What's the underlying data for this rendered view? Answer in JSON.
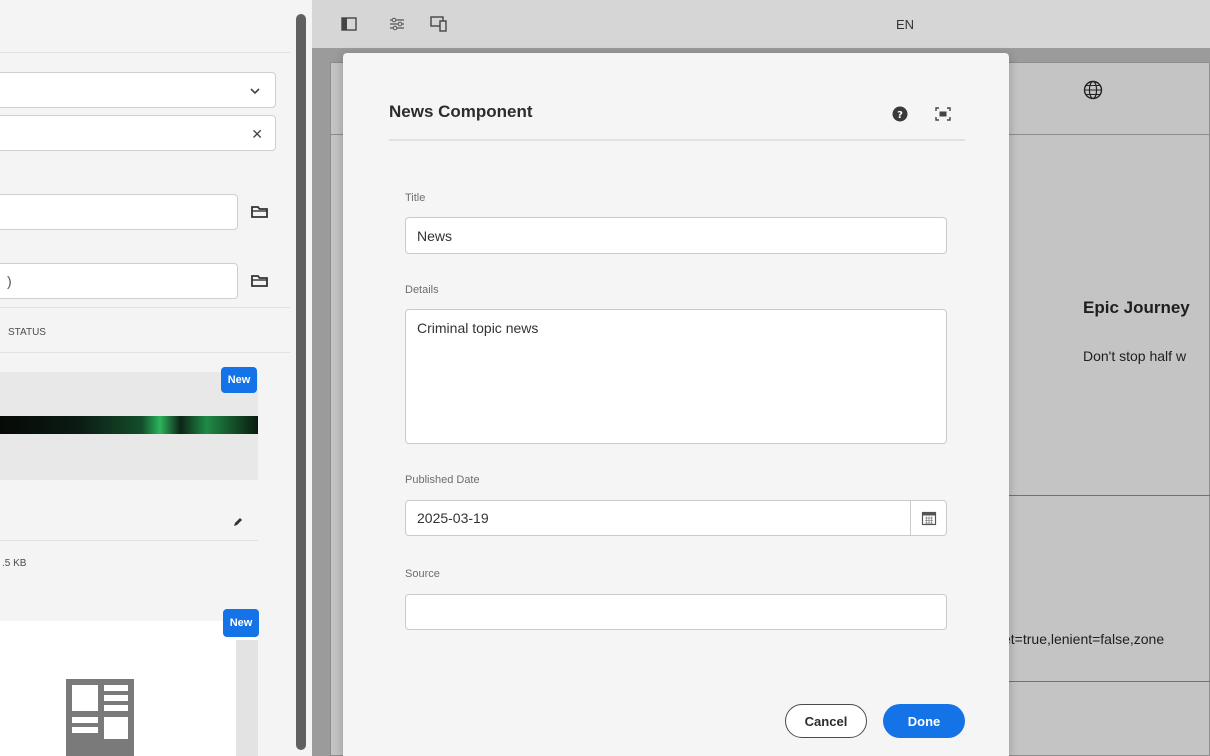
{
  "left_panel": {
    "dropdown_icon": "chevron-down-icon",
    "clear_icon": "close-icon",
    "path_field_1_value": "",
    "path_field_2_value": ")",
    "browse_icon": "folder-icon",
    "status_header": "STATUS",
    "asset_1": {
      "badge": "New",
      "edit_icon": "pencil-icon",
      "size": ".5 KB"
    },
    "asset_2": {
      "badge": "New",
      "thumbnail_icon": "document-icon"
    }
  },
  "toolbar": {
    "icons": [
      "side-panel-icon",
      "properties-icon",
      "emulator-icon"
    ],
    "language": "EN"
  },
  "page_preview": {
    "globe_icon": "globe-icon",
    "heading": "Epic Journey",
    "subtext": "Don't stop half w",
    "params_text": "et=true,lenient=false,zone"
  },
  "dialog": {
    "title": "News Component",
    "help_icon": "help-icon",
    "fullscreen_icon": "fullscreen-icon",
    "fields": {
      "title": {
        "label": "Title",
        "value": "News"
      },
      "details": {
        "label": "Details",
        "value": "Criminal topic news"
      },
      "published_date": {
        "label": "Published Date",
        "value": "2025-03-19",
        "icon": "calendar-icon"
      },
      "source": {
        "label": "Source",
        "value": ""
      }
    },
    "cancel_label": "Cancel",
    "done_label": "Done"
  },
  "colors": {
    "accent": "#1473e6",
    "panel_bg": "#f4f4f4",
    "overlay_bg": "#9b9b9b"
  }
}
